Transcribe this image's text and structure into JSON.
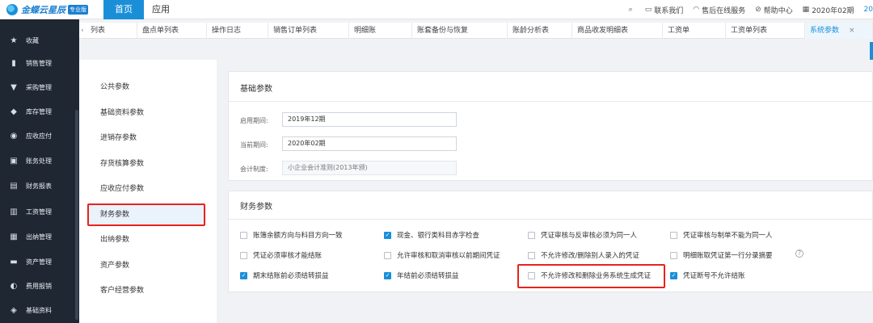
{
  "topbar": {
    "brand": "金蝶云星辰",
    "badge": "专业版",
    "nav_home": "首页",
    "nav_app": "应用",
    "contact": "联系我们",
    "support": "售后在线服务",
    "help": "帮助中心",
    "period": "2020年02期",
    "overflow": "20"
  },
  "sidebar": {
    "items": [
      {
        "label": "收藏",
        "icon": "star-icon",
        "glyph": "★"
      },
      {
        "label": "销售管理",
        "icon": "sales-chart-icon",
        "glyph": "▮"
      },
      {
        "label": "采购管理",
        "icon": "cart-icon",
        "glyph": "▼"
      },
      {
        "label": "库存管理",
        "icon": "box-icon",
        "glyph": "◆"
      },
      {
        "label": "应收应付",
        "icon": "coin-icon",
        "glyph": "◉"
      },
      {
        "label": "账务处理",
        "icon": "ledger-icon",
        "glyph": "▣"
      },
      {
        "label": "财务报表",
        "icon": "report-icon",
        "glyph": "▤"
      },
      {
        "label": "工资管理",
        "icon": "wage-icon",
        "glyph": "▥"
      },
      {
        "label": "出纳管理",
        "icon": "cashier-icon",
        "glyph": "▦"
      },
      {
        "label": "资产管理",
        "icon": "asset-icon",
        "glyph": "▬"
      },
      {
        "label": "费用报销",
        "icon": "expense-icon",
        "glyph": "◐"
      },
      {
        "label": "基础资料",
        "icon": "basic-data-icon",
        "glyph": "◈"
      }
    ]
  },
  "tabs": [
    {
      "label": "列表"
    },
    {
      "label": "盘点单列表"
    },
    {
      "label": "操作日志"
    },
    {
      "label": "销售订单列表"
    },
    {
      "label": "明细账"
    },
    {
      "label": "账套备份与恢复"
    },
    {
      "label": "账龄分析表"
    },
    {
      "label": "商品收发明细表"
    },
    {
      "label": "工资单"
    },
    {
      "label": "工资单列表"
    },
    {
      "label": "系统参数"
    }
  ],
  "left_menu": [
    {
      "label": "公共参数"
    },
    {
      "label": "基础资料参数"
    },
    {
      "label": "进销存参数"
    },
    {
      "label": "存货核算参数"
    },
    {
      "label": "应收应付参数"
    },
    {
      "label": "财务参数"
    },
    {
      "label": "出纳参数"
    },
    {
      "label": "资产参数"
    },
    {
      "label": "客户经营参数"
    }
  ],
  "basic_params": {
    "title": "基础参数",
    "start_label": "启用期间:",
    "start_value": "2019年12期",
    "current_label": "当前期间:",
    "current_value": "2020年02期",
    "system_label": "会计制度:",
    "system_value": "小企业会计准则(2013年颁)"
  },
  "finance_params": {
    "title": "财务参数",
    "checkboxes": [
      {
        "label": "账簿余额方向与科目方向一致",
        "checked": false
      },
      {
        "label": "现金、银行类科目赤字检查",
        "checked": true
      },
      {
        "label": "凭证审核与反审核必须为同一人",
        "checked": false
      },
      {
        "label": "凭证审核与制单不能为同一人",
        "checked": false
      },
      {
        "label": "凭证必须审核才能结账",
        "checked": false
      },
      {
        "label": "允许审核和取消审核以前期间凭证",
        "checked": false
      },
      {
        "label": "不允许修改/删除别人录入的凭证",
        "checked": false
      },
      {
        "label": "明细账取凭证第一行分录摘要",
        "checked": false
      },
      {
        "label": "期末结账前必须结转损益",
        "checked": true
      },
      {
        "label": "年结前必须结转损益",
        "checked": true
      },
      {
        "label": "不允许修改和删除业务系统生成凭证",
        "checked": false
      },
      {
        "label": "凭证断号不允许结账",
        "checked": true
      }
    ]
  },
  "colors": {
    "accent": "#1a8fd8",
    "highlight": "#e8231d",
    "sidebar_bg": "#1f2733"
  }
}
